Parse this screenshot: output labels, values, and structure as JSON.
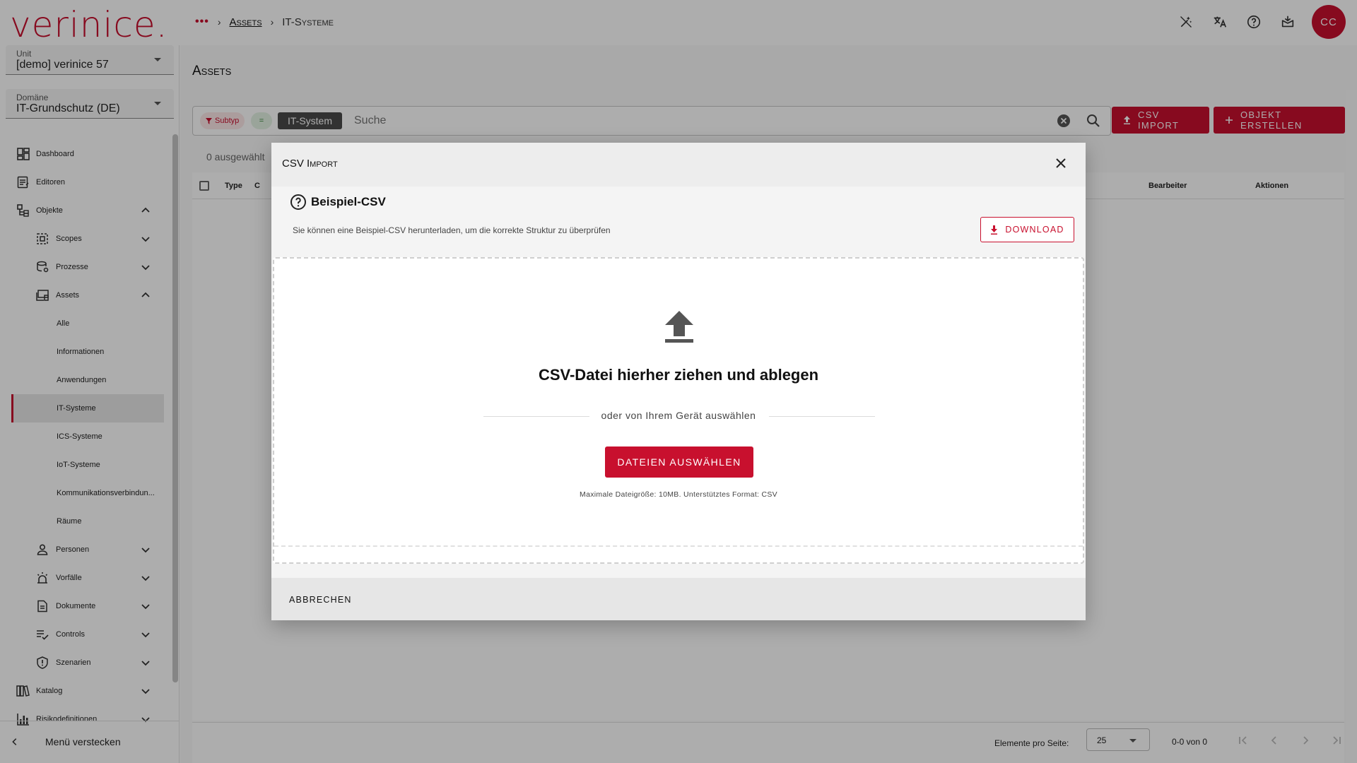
{
  "app": {
    "logo": "verinice."
  },
  "breadcrumb": {
    "more": "•••",
    "sep1": "›",
    "assets": "Assets",
    "sep2": "›",
    "current": "IT-Systeme"
  },
  "header_icons": [
    "magic-icon",
    "translate-icon",
    "help-icon",
    "whats-new-icon"
  ],
  "user": {
    "initials": "CC"
  },
  "sidebar": {
    "unit": {
      "label": "Unit",
      "value": "[demo] verinice 57"
    },
    "domain": {
      "label": "Domäne",
      "value": "IT-Grundschutz (DE)"
    },
    "items": [
      {
        "label": "Dashboard",
        "icon": "dashboard-icon"
      },
      {
        "label": "Editoren",
        "icon": "editor-icon"
      },
      {
        "label": "Objekte",
        "icon": "objects-icon",
        "expanded": true
      },
      {
        "label": "Scopes",
        "icon": "scopes-icon"
      },
      {
        "label": "Prozesse",
        "icon": "process-icon"
      },
      {
        "label": "Assets",
        "icon": "assets-icon",
        "expanded": true
      },
      {
        "label": "Alle"
      },
      {
        "label": "Informationen"
      },
      {
        "label": "Anwendungen"
      },
      {
        "label": "IT-Systeme",
        "active": true
      },
      {
        "label": "ICS-Systeme"
      },
      {
        "label": "IoT-Systeme"
      },
      {
        "label": "Kommunikationsverbindun..."
      },
      {
        "label": "Räume"
      },
      {
        "label": "Personen",
        "icon": "person-icon"
      },
      {
        "label": "Vorfälle",
        "icon": "incident-icon"
      },
      {
        "label": "Dokumente",
        "icon": "document-icon"
      },
      {
        "label": "Controls",
        "icon": "controls-icon"
      },
      {
        "label": "Szenarien",
        "icon": "scenario-icon"
      },
      {
        "label": "Katalog",
        "icon": "catalog-icon"
      },
      {
        "label": "Risikodefinitionen",
        "icon": "risk-icon"
      }
    ],
    "hide_menu": "Menü verstecken"
  },
  "main": {
    "title": "Assets",
    "filter": {
      "chip_subtyp": "Subtyp",
      "chip_eq": "=",
      "chip_value": "IT-System",
      "search_placeholder": "Suche"
    },
    "buttons": {
      "csv_import": "CSV Import",
      "create_object": "Objekt erstellen"
    },
    "selected": "0 ausgewählt",
    "columns": {
      "type": "Type",
      "c2": "C",
      "editor": "Bearbeiter",
      "actions": "Aktionen"
    },
    "pager": {
      "per_page_label": "Elemente pro Seite:",
      "per_page_value": "25",
      "range": "0-0 von 0"
    }
  },
  "dialog": {
    "title": "CSV Import",
    "example_title": "Beispiel-CSV",
    "example_desc": "Sie können eine Beispiel-CSV herunterladen, um die korrekte Struktur zu überprüfen",
    "download": "Download",
    "drop_title": "CSV-Datei hierher ziehen und ablegen",
    "or_text": "oder von Ihrem Gerät auswählen",
    "choose_files": "Dateien auswählen",
    "hint": "Maximale Dateigröße: 10MB. Unterstütztes Format: CSV",
    "cancel": "Abbrechen"
  },
  "colors": {
    "brand": "#c8102e",
    "overlay": "rgba(0,0,0,0.32)"
  }
}
